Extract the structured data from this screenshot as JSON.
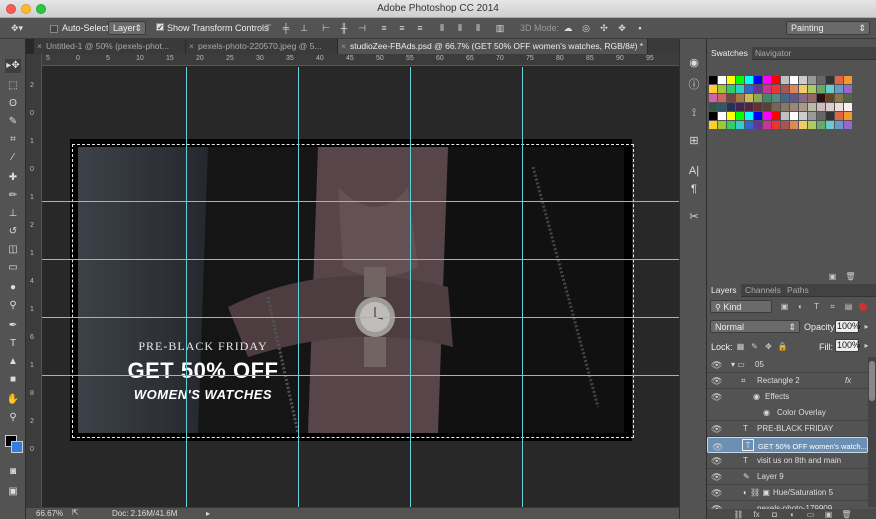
{
  "window": {
    "title": "Adobe Photoshop CC 2014"
  },
  "options_bar": {
    "auto_select_label": "Auto-Select:",
    "auto_select_value": "Layer",
    "show_transform_label": "Show Transform Controls",
    "mode_3d_label": "3D Mode:",
    "workspace": "Painting"
  },
  "tabs": [
    {
      "label": "Untitled-1 @ 50% (pexels-phot..."
    },
    {
      "label": "pexels-photo-220570.jpeg @ 5..."
    },
    {
      "label": "studioZee-FBAds.psd @ 66.7% (GET 50% OFF women's watches, RGB/8#) *"
    }
  ],
  "ruler_top": [
    "5",
    "0",
    "5",
    "10",
    "15",
    "20",
    "25",
    "30",
    "35",
    "40",
    "45",
    "50",
    "55",
    "60",
    "65",
    "70",
    "75",
    "80",
    "85",
    "90",
    "95"
  ],
  "ruler_left": [
    "2",
    "0",
    "1",
    "0",
    "1",
    "2",
    "1",
    "4",
    "1",
    "6",
    "1",
    "8",
    "2",
    "0"
  ],
  "ad": {
    "line1": "PRE-BLACK FRIDAY",
    "line2": "GET 50% OFF",
    "line3": "WOMEN'S WATCHES"
  },
  "status": {
    "zoom": "66.67%",
    "doc": "Doc: 2.16M/41.6M"
  },
  "swatches_panel": {
    "tabs": [
      "Swatches",
      "Navigator"
    ]
  },
  "layers_panel": {
    "tabs": [
      "Layers",
      "Channels",
      "Paths"
    ],
    "filter": "Kind",
    "blend_mode": "Normal",
    "opacity_label": "Opacity:",
    "opacity": "100%",
    "lock_label": "Lock:",
    "fill_label": "Fill:",
    "fill": "100%",
    "layers": [
      {
        "name": "05",
        "kind": "group"
      },
      {
        "name": "Rectangle 2",
        "kind": "shape",
        "fx": "fx"
      },
      {
        "name": "Effects",
        "kind": "effects"
      },
      {
        "name": "Color Overlay",
        "kind": "effect"
      },
      {
        "name": "PRE-BLACK FRIDAY",
        "kind": "text"
      },
      {
        "name": "GET 50% OFF women's watch...",
        "kind": "text",
        "selected": true
      },
      {
        "name": "visit us on 8th and main",
        "kind": "text"
      },
      {
        "name": "Layer 9",
        "kind": "pixel"
      },
      {
        "name": "Hue/Saturation 5",
        "kind": "adjustment"
      },
      {
        "name": "pexels-photo-179909",
        "kind": "pixel"
      }
    ]
  },
  "colors": {
    "guide": "#5fd0d6",
    "selection": "#6c8fb4"
  }
}
